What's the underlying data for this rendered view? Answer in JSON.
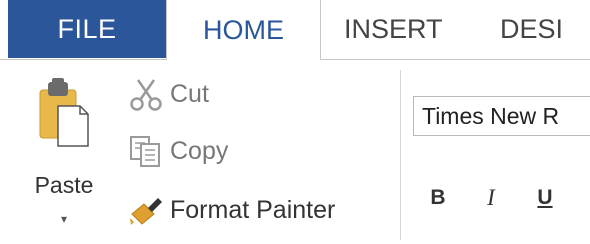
{
  "tabs": {
    "file": "FILE",
    "home": "HOME",
    "insert": "INSERT",
    "design": "DESI"
  },
  "clipboard": {
    "paste": "Paste",
    "paste_dropdown": "▾",
    "cut": "Cut",
    "copy": "Copy",
    "format_painter": "Format Painter"
  },
  "font": {
    "font_name": "Times New R",
    "bold": "B",
    "italic": "I",
    "underline": "U"
  },
  "colors": {
    "file_tab_bg": "#2b579a",
    "home_tab_text": "#2b579a",
    "paste_clipboard": "#e8b84a",
    "format_painter_brush": "#e0a030"
  },
  "icons": {
    "paste": "paste-icon",
    "cut": "scissors-icon",
    "copy": "copy-icon",
    "format_painter": "paintbrush-icon"
  }
}
